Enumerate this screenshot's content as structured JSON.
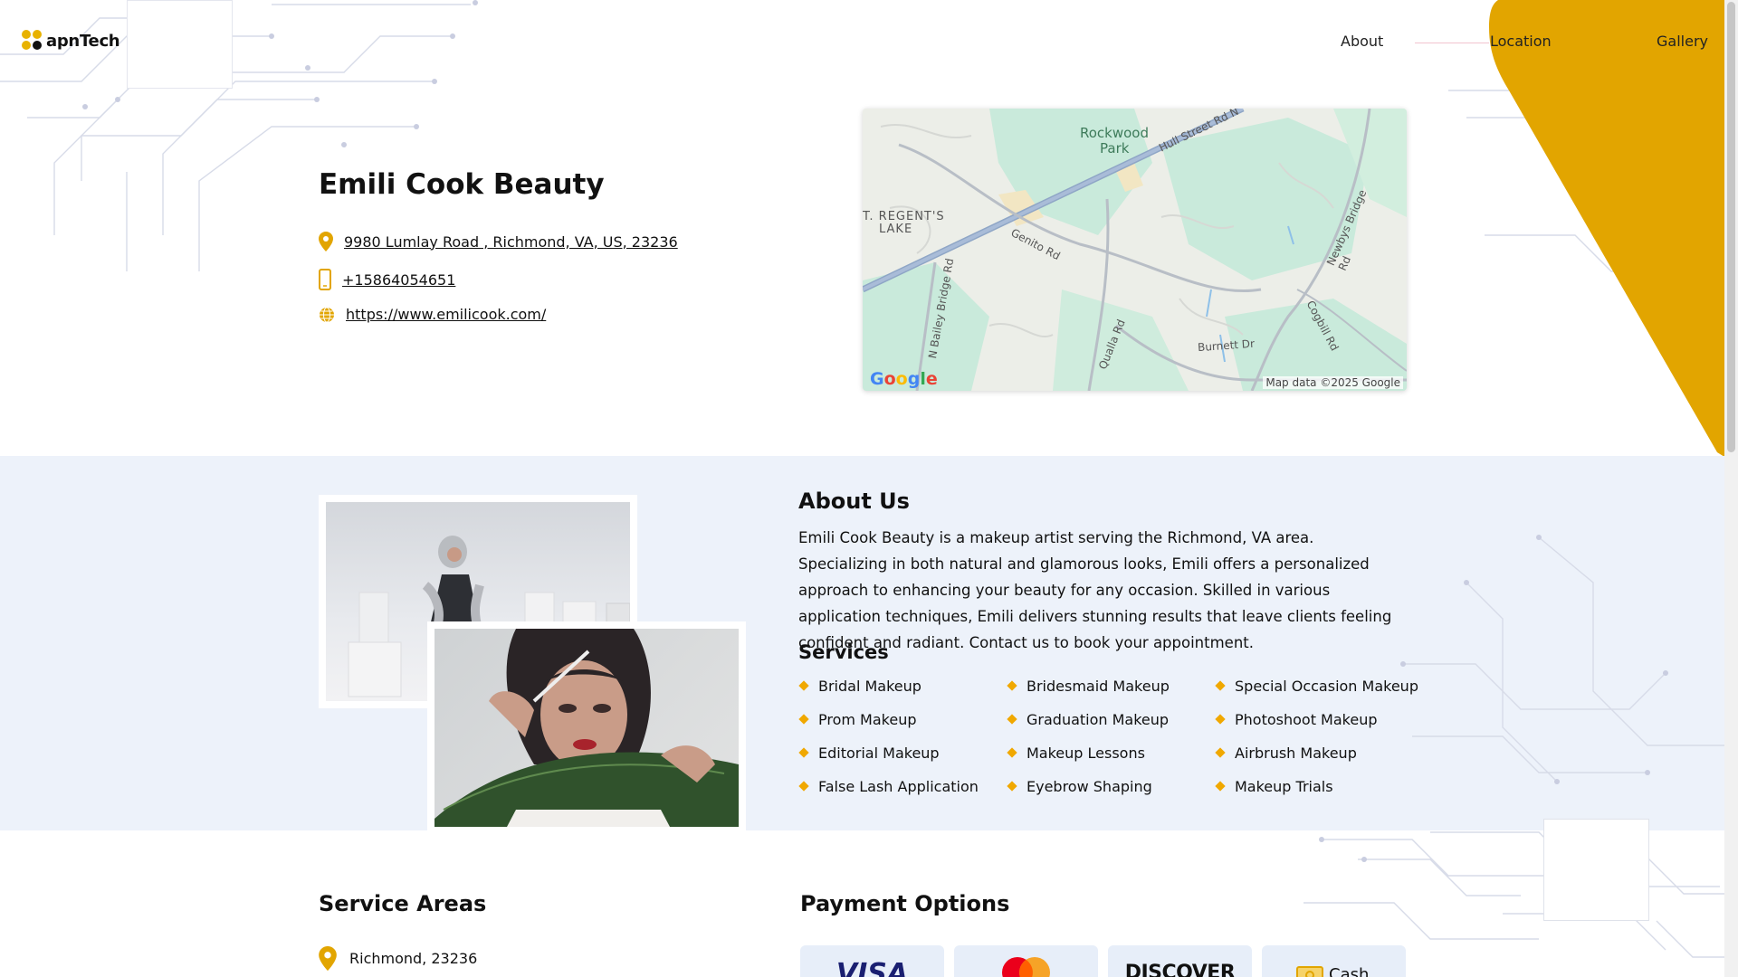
{
  "brand": {
    "logo_text": "apnTech"
  },
  "nav": {
    "about": "About",
    "location": "Location",
    "gallery": "Gallery"
  },
  "business": {
    "name": "Emili Cook Beauty",
    "address": "9980 Lumlay Road , Richmond, VA, US, 23236",
    "phone": "+15864054651",
    "website": "https://www.emilicook.com/"
  },
  "map": {
    "labels": [
      "Rockwood",
      "Park",
      "Hull Street Rd N",
      "T. REGENT'S",
      "LAKE",
      "Genito Rd",
      "Newbys Bridge Rd",
      "N Bailey Bridge Rd",
      "Qualla Rd",
      "Burnett Dr",
      "Cogbill Rd"
    ],
    "logo": "Google",
    "credit": "Map data ©2025 Google"
  },
  "about": {
    "title": "About Us",
    "text": "Emili Cook Beauty is a makeup artist serving the Richmond, VA area. Specializing in both natural and glamorous looks, Emili offers a personalized approach to enhancing your beauty for any occasion. Skilled in various application techniques, Emili delivers stunning results that leave clients feeling confident and radiant. Contact us to book your appointment."
  },
  "services": {
    "title": "Services",
    "items": [
      "Bridal Makeup",
      "Bridesmaid Makeup",
      "Special Occasion Makeup",
      "Prom Makeup",
      "Graduation Makeup",
      "Photoshoot Makeup",
      "Editorial Makeup",
      "Makeup Lessons",
      "Airbrush Makeup",
      "False Lash Application",
      "Eyebrow Shaping",
      "Makeup Trials"
    ]
  },
  "service_areas": {
    "title": "Service Areas",
    "items": [
      "Richmond, 23236"
    ]
  },
  "payment": {
    "title": "Payment Options",
    "methods": [
      "VISA",
      "Mastercard",
      "DISCOVER",
      "Cash"
    ]
  },
  "colors": {
    "accent": "#E2A500",
    "band": "#EDF2FA"
  }
}
